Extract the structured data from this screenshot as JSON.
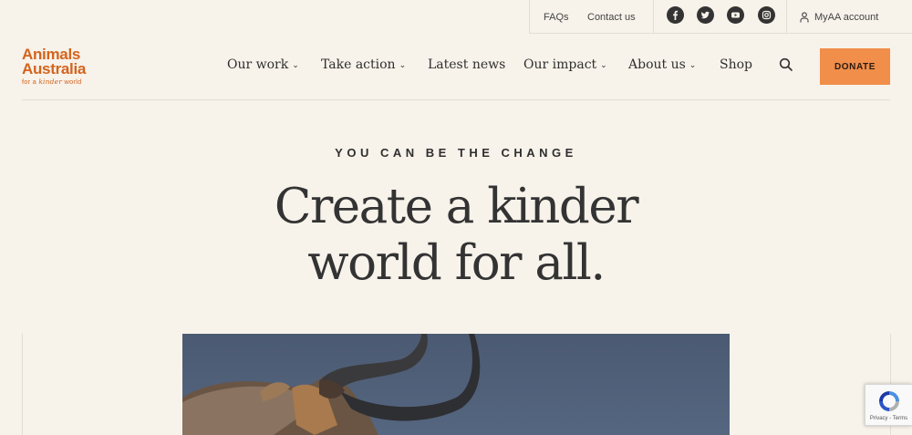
{
  "utility": {
    "faqs": "FAQs",
    "contact": "Contact us",
    "account": "MyAA account",
    "social": [
      "facebook-icon",
      "twitter-icon",
      "youtube-icon",
      "instagram-icon"
    ]
  },
  "logo": {
    "line1": "Animals",
    "line2": "Australia",
    "tag_prefix": "for a",
    "tag_kinder": "kinder",
    "tag_suffix": "world",
    "color": "#d3641e"
  },
  "nav": {
    "our_work": "Our work",
    "take_action": "Take action",
    "latest_news": "Latest news",
    "our_impact": "Our impact",
    "about_us": "About us",
    "shop": "Shop",
    "chevron": "⌄",
    "donate": "DONATE",
    "donate_color": "#f08e4a"
  },
  "hero": {
    "eyebrow": "YOU CAN BE THE CHANGE",
    "headline_line1": "Create a kinder",
    "headline_line2": "world for all.",
    "image": "bull-with-horns-photo"
  },
  "recaptcha": {
    "footer": "Privacy - Terms"
  }
}
